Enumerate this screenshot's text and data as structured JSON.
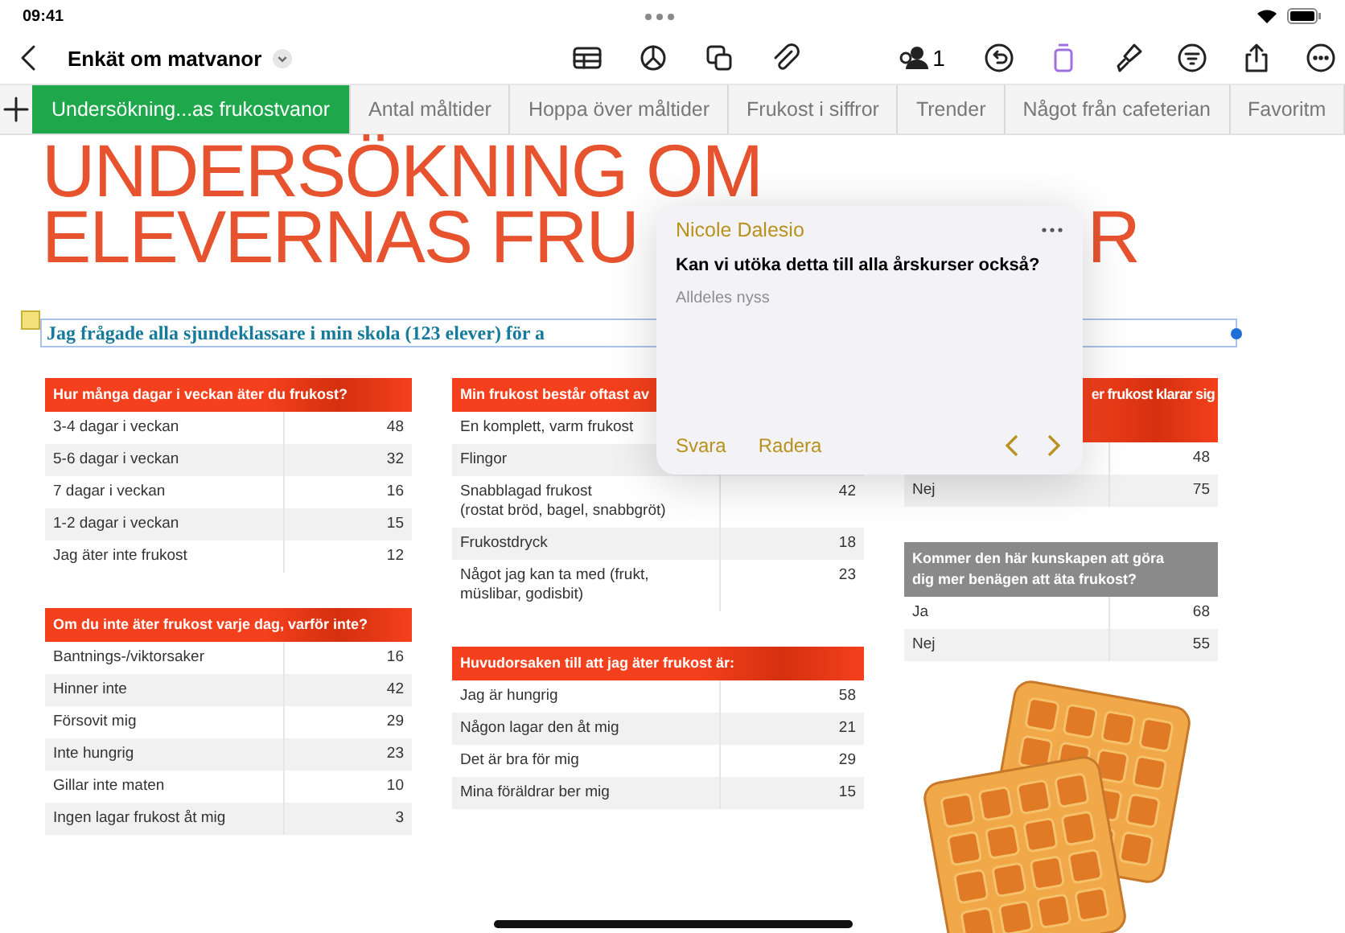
{
  "status_bar": {
    "time": "09:41"
  },
  "toolbar": {
    "document_title": "Enkät om matvanor",
    "collaborator_count": "1"
  },
  "sheet_tabs": [
    {
      "label": "Undersökning...as frukostvanor",
      "selected": true
    },
    {
      "label": "Antal måltider",
      "selected": false
    },
    {
      "label": "Hoppa över måltider",
      "selected": false
    },
    {
      "label": "Frukost i siffror",
      "selected": false
    },
    {
      "label": "Trender",
      "selected": false
    },
    {
      "label": "Något från cafeterian",
      "selected": false
    },
    {
      "label": "Favoritm",
      "selected": false
    }
  ],
  "title": {
    "line_1": "UNDERSÖKNING OM",
    "line_2_start": "ELEVERNAS FRU",
    "line_2_end": "R"
  },
  "subtitle": "Jag frågade alla sjundeklassare i min skola (123 elever) för a",
  "columns": [
    {
      "tables": [
        {
          "header": "Hur många dagar i veckan äter du frukost?",
          "kind": "accent",
          "header_cut_off": false,
          "rows": [
            {
              "label": "3-4 dagar i veckan",
              "value": "48"
            },
            {
              "label": "5-6 dagar i veckan",
              "value": "32"
            },
            {
              "label": "7 dagar i veckan",
              "value": "16"
            },
            {
              "label": "1-2 dagar i veckan",
              "value": "15"
            },
            {
              "label": "Jag äter inte frukost",
              "value": "12"
            }
          ]
        },
        {
          "header": "Om du inte äter frukost varje dag, varför inte?",
          "kind": "accent",
          "header_cut_off": false,
          "rows": [
            {
              "label": "Bantnings-/viktorsaker",
              "value": "16"
            },
            {
              "label": "Hinner inte",
              "value": "42"
            },
            {
              "label": "Försovit mig",
              "value": "29"
            },
            {
              "label": "Inte hungrig",
              "value": "23"
            },
            {
              "label": "Gillar inte maten",
              "value": "10"
            },
            {
              "label": "Ingen lagar frukost åt mig",
              "value": "3"
            }
          ]
        }
      ]
    },
    {
      "tables": [
        {
          "header": "Min frukost består oftast av",
          "kind": "accent",
          "header_cut_off": false,
          "rows": [
            {
              "label": "En komplett, varm frukost"
            },
            {
              "label": "Flingor"
            },
            {
              "label": "Snabblagad frukost\n(rostat bröd, bagel, snabbgröt)",
              "value": "42"
            },
            {
              "label": "Frukostdryck",
              "value": "18"
            },
            {
              "label": "Något jag kan ta med (frukt, müslibar, godisbit)",
              "value": "23"
            }
          ]
        },
        {
          "header": "Huvudorsaken till att jag äter frukost är:",
          "kind": "accent",
          "header_cut_off": false,
          "rows": [
            {
              "label": "Jag är hungrig",
              "value": "58"
            },
            {
              "label": "Någon lagar den åt mig",
              "value": "21"
            },
            {
              "label": "Det är bra för mig",
              "value": "29"
            },
            {
              "label": "Mina föräldrar ber mig",
              "value": "15"
            }
          ]
        }
      ]
    },
    {
      "tables": [
        {
          "header": "er frukost klarar sig",
          "kind": "accent",
          "header_cut_off": true,
          "rows": [
            {
              "value": "48"
            },
            {
              "label": "Nej",
              "value": "75"
            }
          ]
        },
        {
          "header": "Kommer den här kunskapen att göra\ndig mer benägen att äta frukost?",
          "kind": "muted",
          "header_cut_off": false,
          "rows": [
            {
              "label": "Ja",
              "value": "68"
            },
            {
              "label": "Nej",
              "value": "55"
            }
          ]
        }
      ]
    }
  ],
  "comment": {
    "author": "Nicole Dalesio",
    "text": "Kan vi utöka detta till alla årskurser också?",
    "time": "Alldeles nyss",
    "actions": [
      "Svara",
      "Radera"
    ]
  }
}
